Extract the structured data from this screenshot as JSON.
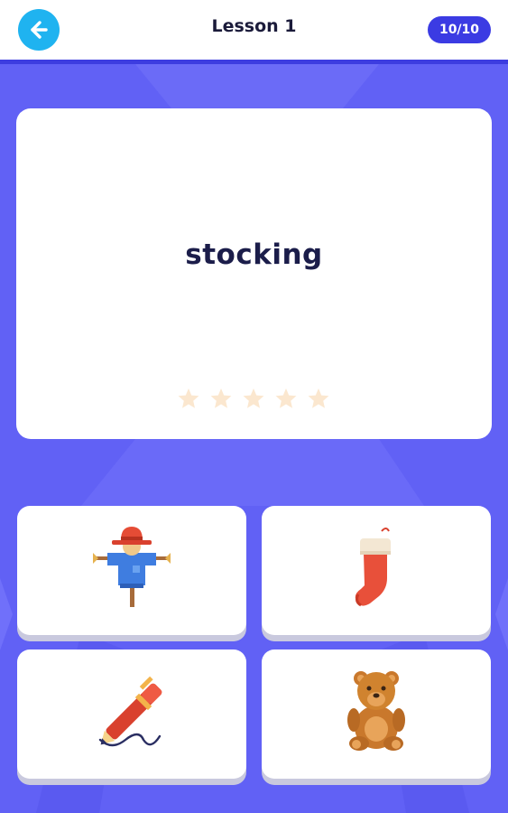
{
  "header": {
    "back_icon": "arrow-left-icon",
    "title": "Lesson 1",
    "progress": "10/10",
    "colors": {
      "back": "#1fb3f0",
      "pill": "#3b3be3",
      "accent_line": "#3d3de0"
    }
  },
  "card": {
    "word": "stocking",
    "star_count": 5,
    "stars_filled": 0,
    "star_color": "#fbe7cf"
  },
  "options": [
    {
      "icon": "scarecrow-icon"
    },
    {
      "icon": "stocking-icon"
    },
    {
      "icon": "pen-icon"
    },
    {
      "icon": "teddy-bear-icon"
    }
  ],
  "background_color": "#6161f5"
}
